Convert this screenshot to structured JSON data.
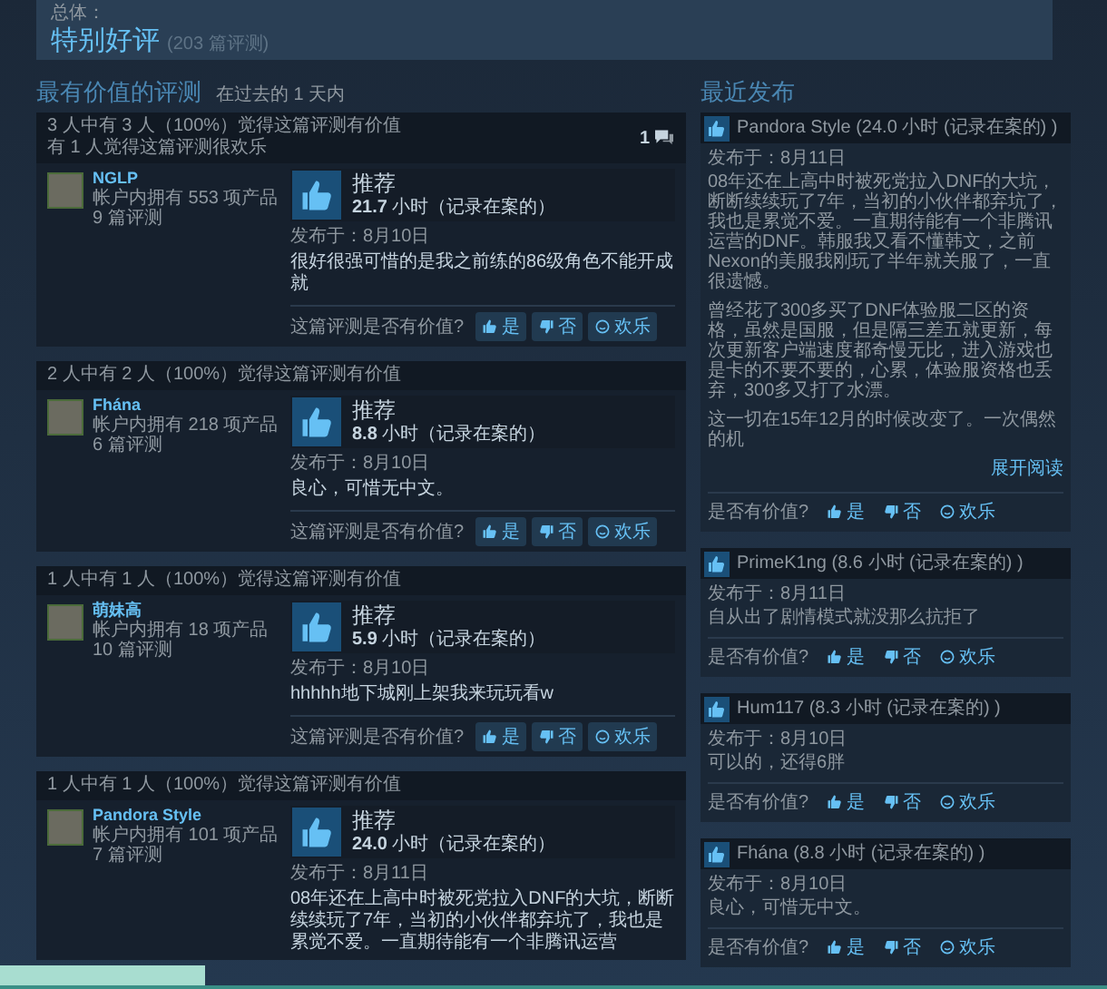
{
  "summary": {
    "label": "总体：",
    "rating": "特别好评",
    "count": "(203 篇评测)"
  },
  "most_helpful": {
    "title": "最有价值的评测",
    "period": "在过去的 1 天内",
    "reviews": [
      {
        "helpful_lines": [
          "3 人中有 3 人（100%）觉得这篇评测有价值",
          "有 1 人觉得这篇评测很欢乐"
        ],
        "comment_count": "1",
        "author": {
          "name": "NGLP",
          "products": "帐户内拥有 553 项产品",
          "reviews": "9 篇评测"
        },
        "verdict": "推荐",
        "hours": "**21.7** 小时（记录在案的）",
        "date": "发布于：8月10日",
        "text": "很好很强可惜的是我之前练的86级角色不能开成就",
        "prompt": "这篇评测是否有价值?",
        "buttons": [
          "是",
          "否",
          "欢乐"
        ]
      },
      {
        "helpful_lines": [
          "2 人中有 2 人（100%）觉得这篇评测有价值"
        ],
        "author": {
          "name": "Fhána",
          "products": "帐户内拥有 218 项产品",
          "reviews": "6 篇评测"
        },
        "verdict": "推荐",
        "hours": "**8.8** 小时（记录在案的）",
        "date": "发布于：8月10日",
        "text": "良心，可惜无中文。",
        "prompt": "这篇评测是否有价值?",
        "buttons": [
          "是",
          "否",
          "欢乐"
        ]
      },
      {
        "helpful_lines": [
          "1 人中有 1 人（100%）觉得这篇评测有价值"
        ],
        "author": {
          "name": "萌妹高",
          "products": "帐户内拥有 18 项产品",
          "reviews": "10 篇评测"
        },
        "verdict": "推荐",
        "hours": "**5.9** 小时（记录在案的）",
        "date": "发布于：8月10日",
        "text": "hhhhh地下城刚上架我来玩玩看w",
        "prompt": "这篇评测是否有价值?",
        "buttons": [
          "是",
          "否",
          "欢乐"
        ]
      },
      {
        "helpful_lines": [
          "1 人中有 1 人（100%）觉得这篇评测有价值"
        ],
        "author": {
          "name": "Pandora Style",
          "products": "帐户内拥有 101 项产品",
          "reviews": "7 篇评测"
        },
        "verdict": "推荐",
        "hours": "**24.0** 小时（记录在案的）",
        "date": "发布于：8月11日",
        "text": "08年还在上高中时被死党拉入DNF的大坑，断断续续玩了7年，当初的小伙伴都弃坑了，我也是累觉不爱。一直期待能有一个非腾讯运营"
      }
    ]
  },
  "recent": {
    "title": "最近发布",
    "reviews": [
      {
        "author_line": "Pandora Style (24.0 小时 (记录在案的) )",
        "date": "发布于：8月11日",
        "paragraphs": [
          "08年还在上高中时被死党拉入DNF的大坑，断断续续玩了7年，当初的小伙伴都弃坑了，我也是累觉不爱。一直期待能有一个非腾讯运营的DNF。韩服我又看不懂韩文，之前Nexon的美服我刚玩了半年就关服了，一直很遗憾。",
          "曾经花了300多买了DNF体验服二区的资格，虽然是国服，但是隔三差五就更新，每次更新客户端速度都奇慢无比，进入游戏也是卡的不要不要的，心累，体验服资格也丢弃，300多又打了水漂。",
          "这一切在15年12月的时候改变了。一次偶然的机"
        ],
        "expand": "展开阅读",
        "prompt": "是否有价值?",
        "buttons": [
          "是",
          "否",
          "欢乐"
        ]
      },
      {
        "author_line": "PrimeK1ng (8.6 小时 (记录在案的) )",
        "date": "发布于：8月11日",
        "paragraphs": [
          "自从出了剧情模式就没那么抗拒了"
        ],
        "prompt": "是否有价值?",
        "buttons": [
          "是",
          "否",
          "欢乐"
        ]
      },
      {
        "author_line": "Hum117 (8.3 小时 (记录在案的) )",
        "date": "发布于：8月10日",
        "paragraphs": [
          "可以的，还得6胖"
        ],
        "prompt": "是否有价值?",
        "buttons": [
          "是",
          "否",
          "欢乐"
        ]
      },
      {
        "author_line": "Fhána (8.8 小时 (记录在案的) )",
        "date": "发布于：8月10日",
        "paragraphs": [
          "良心，可惜无中文。"
        ],
        "prompt": "是否有价值?",
        "buttons": [
          "是",
          "否",
          "欢乐"
        ]
      }
    ]
  }
}
